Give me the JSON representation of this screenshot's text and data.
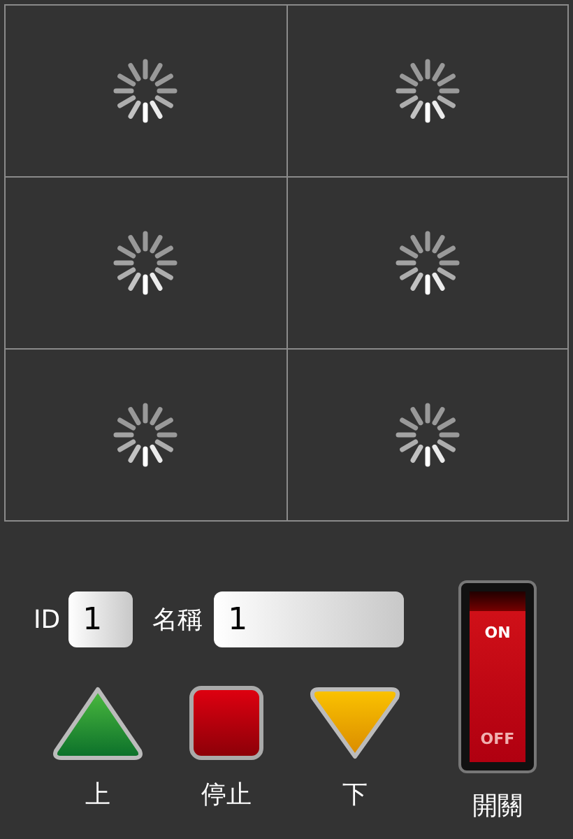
{
  "video_cells": [
    {
      "kind": "loading"
    },
    {
      "kind": "loading"
    },
    {
      "kind": "loading"
    },
    {
      "kind": "loading"
    },
    {
      "kind": "loading"
    },
    {
      "kind": "loading"
    }
  ],
  "id_field": {
    "label": "ID",
    "value": "1"
  },
  "name_field": {
    "label": "名稱",
    "value": "1"
  },
  "buttons": [
    {
      "kind": "up",
      "label": "上"
    },
    {
      "kind": "stop",
      "label": "停止"
    },
    {
      "kind": "down",
      "label": "下"
    }
  ],
  "switch": {
    "on": true,
    "on_text": "ON",
    "off_text": "OFF",
    "label": "開關"
  }
}
